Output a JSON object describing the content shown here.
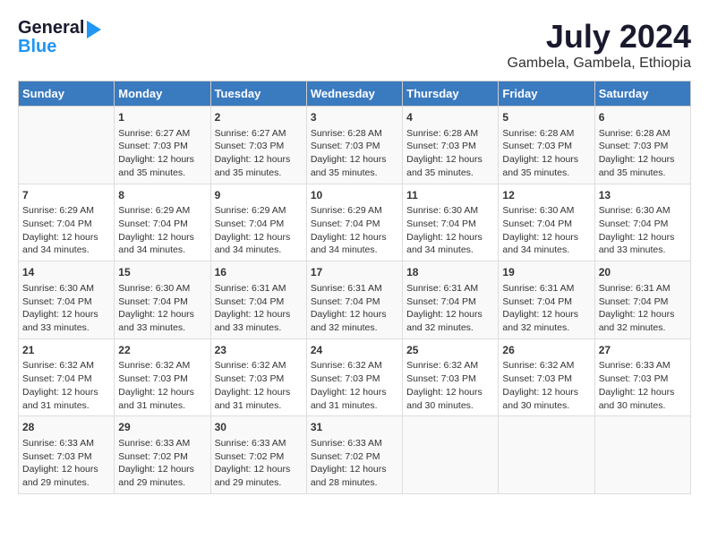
{
  "header": {
    "logo_general": "General",
    "logo_blue": "Blue",
    "month_year": "July 2024",
    "location": "Gambela, Gambela, Ethiopia"
  },
  "days_of_week": [
    "Sunday",
    "Monday",
    "Tuesday",
    "Wednesday",
    "Thursday",
    "Friday",
    "Saturday"
  ],
  "weeks": [
    [
      {
        "day": "",
        "info": ""
      },
      {
        "day": "1",
        "info": "Sunrise: 6:27 AM\nSunset: 7:03 PM\nDaylight: 12 hours\nand 35 minutes."
      },
      {
        "day": "2",
        "info": "Sunrise: 6:27 AM\nSunset: 7:03 PM\nDaylight: 12 hours\nand 35 minutes."
      },
      {
        "day": "3",
        "info": "Sunrise: 6:28 AM\nSunset: 7:03 PM\nDaylight: 12 hours\nand 35 minutes."
      },
      {
        "day": "4",
        "info": "Sunrise: 6:28 AM\nSunset: 7:03 PM\nDaylight: 12 hours\nand 35 minutes."
      },
      {
        "day": "5",
        "info": "Sunrise: 6:28 AM\nSunset: 7:03 PM\nDaylight: 12 hours\nand 35 minutes."
      },
      {
        "day": "6",
        "info": "Sunrise: 6:28 AM\nSunset: 7:03 PM\nDaylight: 12 hours\nand 35 minutes."
      }
    ],
    [
      {
        "day": "7",
        "info": "Sunrise: 6:29 AM\nSunset: 7:04 PM\nDaylight: 12 hours\nand 34 minutes."
      },
      {
        "day": "8",
        "info": "Sunrise: 6:29 AM\nSunset: 7:04 PM\nDaylight: 12 hours\nand 34 minutes."
      },
      {
        "day": "9",
        "info": "Sunrise: 6:29 AM\nSunset: 7:04 PM\nDaylight: 12 hours\nand 34 minutes."
      },
      {
        "day": "10",
        "info": "Sunrise: 6:29 AM\nSunset: 7:04 PM\nDaylight: 12 hours\nand 34 minutes."
      },
      {
        "day": "11",
        "info": "Sunrise: 6:30 AM\nSunset: 7:04 PM\nDaylight: 12 hours\nand 34 minutes."
      },
      {
        "day": "12",
        "info": "Sunrise: 6:30 AM\nSunset: 7:04 PM\nDaylight: 12 hours\nand 34 minutes."
      },
      {
        "day": "13",
        "info": "Sunrise: 6:30 AM\nSunset: 7:04 PM\nDaylight: 12 hours\nand 33 minutes."
      }
    ],
    [
      {
        "day": "14",
        "info": "Sunrise: 6:30 AM\nSunset: 7:04 PM\nDaylight: 12 hours\nand 33 minutes."
      },
      {
        "day": "15",
        "info": "Sunrise: 6:30 AM\nSunset: 7:04 PM\nDaylight: 12 hours\nand 33 minutes."
      },
      {
        "day": "16",
        "info": "Sunrise: 6:31 AM\nSunset: 7:04 PM\nDaylight: 12 hours\nand 33 minutes."
      },
      {
        "day": "17",
        "info": "Sunrise: 6:31 AM\nSunset: 7:04 PM\nDaylight: 12 hours\nand 32 minutes."
      },
      {
        "day": "18",
        "info": "Sunrise: 6:31 AM\nSunset: 7:04 PM\nDaylight: 12 hours\nand 32 minutes."
      },
      {
        "day": "19",
        "info": "Sunrise: 6:31 AM\nSunset: 7:04 PM\nDaylight: 12 hours\nand 32 minutes."
      },
      {
        "day": "20",
        "info": "Sunrise: 6:31 AM\nSunset: 7:04 PM\nDaylight: 12 hours\nand 32 minutes."
      }
    ],
    [
      {
        "day": "21",
        "info": "Sunrise: 6:32 AM\nSunset: 7:04 PM\nDaylight: 12 hours\nand 31 minutes."
      },
      {
        "day": "22",
        "info": "Sunrise: 6:32 AM\nSunset: 7:03 PM\nDaylight: 12 hours\nand 31 minutes."
      },
      {
        "day": "23",
        "info": "Sunrise: 6:32 AM\nSunset: 7:03 PM\nDaylight: 12 hours\nand 31 minutes."
      },
      {
        "day": "24",
        "info": "Sunrise: 6:32 AM\nSunset: 7:03 PM\nDaylight: 12 hours\nand 31 minutes."
      },
      {
        "day": "25",
        "info": "Sunrise: 6:32 AM\nSunset: 7:03 PM\nDaylight: 12 hours\nand 30 minutes."
      },
      {
        "day": "26",
        "info": "Sunrise: 6:32 AM\nSunset: 7:03 PM\nDaylight: 12 hours\nand 30 minutes."
      },
      {
        "day": "27",
        "info": "Sunrise: 6:33 AM\nSunset: 7:03 PM\nDaylight: 12 hours\nand 30 minutes."
      }
    ],
    [
      {
        "day": "28",
        "info": "Sunrise: 6:33 AM\nSunset: 7:03 PM\nDaylight: 12 hours\nand 29 minutes."
      },
      {
        "day": "29",
        "info": "Sunrise: 6:33 AM\nSunset: 7:02 PM\nDaylight: 12 hours\nand 29 minutes."
      },
      {
        "day": "30",
        "info": "Sunrise: 6:33 AM\nSunset: 7:02 PM\nDaylight: 12 hours\nand 29 minutes."
      },
      {
        "day": "31",
        "info": "Sunrise: 6:33 AM\nSunset: 7:02 PM\nDaylight: 12 hours\nand 28 minutes."
      },
      {
        "day": "",
        "info": ""
      },
      {
        "day": "",
        "info": ""
      },
      {
        "day": "",
        "info": ""
      }
    ]
  ]
}
